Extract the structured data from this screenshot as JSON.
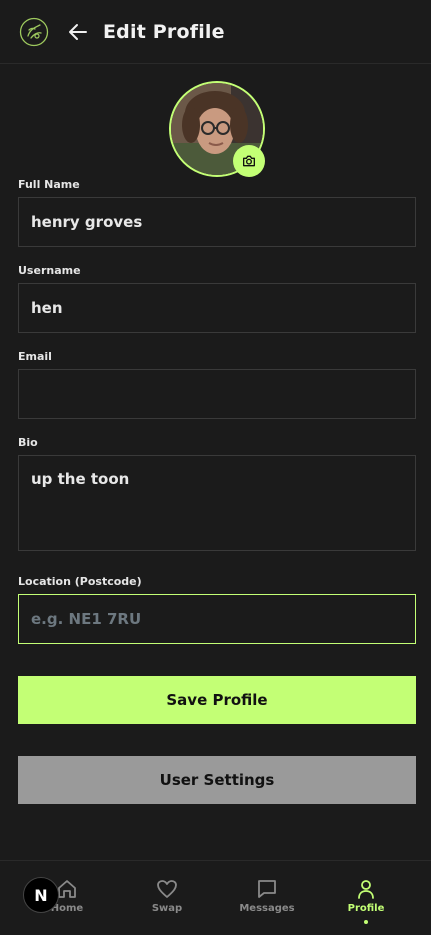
{
  "header": {
    "title": "Edit Profile"
  },
  "form": {
    "full_name_label": "Full Name",
    "full_name_value": "henry groves",
    "username_label": "Username",
    "username_value": "hen",
    "email_label": "Email",
    "email_value": "",
    "bio_label": "Bio",
    "bio_value": "up the toon",
    "location_label": "Location (Postcode)",
    "location_placeholder": "e.g. NE1 7RU"
  },
  "buttons": {
    "save_label": "Save Profile",
    "settings_label": "User Settings"
  },
  "nav": {
    "items": [
      {
        "label": "Home",
        "icon": "home-icon"
      },
      {
        "label": "Swap",
        "icon": "heart-icon"
      },
      {
        "label": "Messages",
        "icon": "message-icon"
      },
      {
        "label": "Profile",
        "icon": "user-icon"
      }
    ],
    "active": "Profile"
  },
  "badge": {
    "text": "N"
  },
  "colors": {
    "accent": "#c3ff75",
    "background": "#1b1b1b",
    "secondary_button": "#9a9a9a"
  }
}
